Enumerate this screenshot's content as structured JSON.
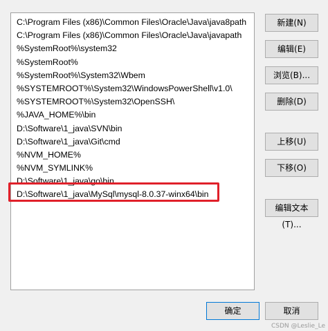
{
  "path_list": {
    "items": [
      "C:\\Program Files (x86)\\Common Files\\Oracle\\Java\\java8path",
      "C:\\Program Files (x86)\\Common Files\\Oracle\\Java\\javapath",
      "%SystemRoot%\\system32",
      "%SystemRoot%",
      "%SystemRoot%\\System32\\Wbem",
      "%SYSTEMROOT%\\System32\\WindowsPowerShell\\v1.0\\",
      "%SYSTEMROOT%\\System32\\OpenSSH\\",
      "%JAVA_HOME%\\bin",
      "D:\\Software\\1_java\\SVN\\bin",
      "D:\\Software\\1_java\\Git\\cmd",
      "%NVM_HOME%",
      "%NVM_SYMLINK%",
      "D:\\Software\\1_java\\go\\bin",
      "D:\\Software\\1_java\\MySql\\mysql-8.0.37-winx64\\bin"
    ],
    "highlight_color": "#e0202a"
  },
  "buttons": {
    "new": "新建(N)",
    "edit": "编辑(E)",
    "browse": "浏览(B)...",
    "delete": "删除(D)",
    "move_up": "上移(U)",
    "move_down": "下移(O)",
    "edit_text": "编辑文本(T)...",
    "ok": "确定",
    "cancel": "取消"
  },
  "watermark": "CSDN @Leslie_Le"
}
